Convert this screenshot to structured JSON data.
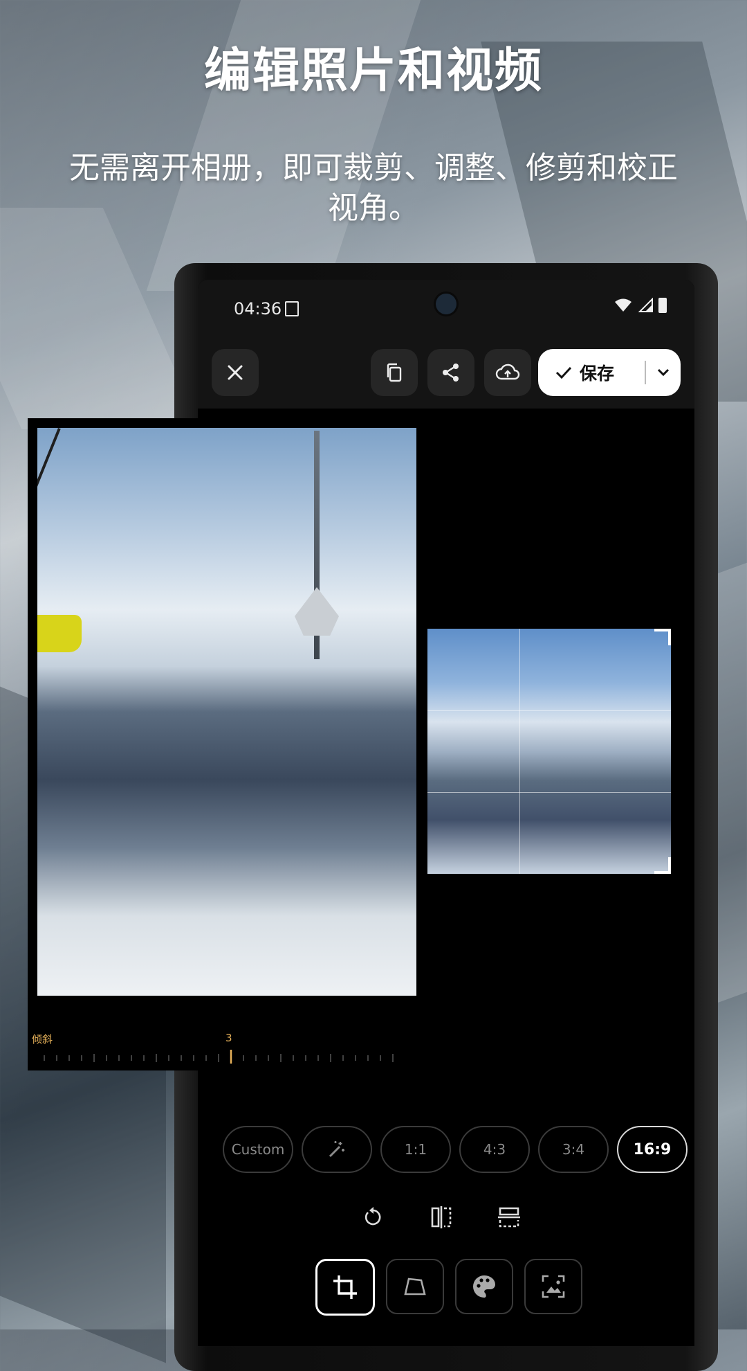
{
  "headline": "编辑照片和视频",
  "subline": "无需离开相册，即可裁剪、调整、修剪和校正视角。",
  "status": {
    "time": "04:36"
  },
  "toolbar": {
    "close_icon": "close-icon",
    "copy_icon": "copy-icon",
    "share_icon": "share-icon",
    "upload_icon": "cloud-upload-icon",
    "save_label": "保存"
  },
  "tilt": {
    "label": "倾斜",
    "value": "3"
  },
  "ratios": [
    {
      "label": "Custom",
      "active": false
    },
    {
      "label": "",
      "icon": "magic-wand-icon",
      "active": false
    },
    {
      "label": "1:1",
      "active": false
    },
    {
      "label": "4:3",
      "active": false
    },
    {
      "label": "3:4",
      "active": false
    },
    {
      "label": "16:9",
      "active": true
    }
  ],
  "tools": [
    "rotate-icon",
    "flip-horizontal-icon",
    "flip-vertical-icon"
  ],
  "tabs": [
    {
      "icon": "crop-icon",
      "active": true
    },
    {
      "icon": "perspective-icon",
      "active": false
    },
    {
      "icon": "palette-icon",
      "active": false
    },
    {
      "icon": "expand-image-icon",
      "active": false
    }
  ],
  "colors": {
    "accent": "#e7b25a",
    "background": "#000000",
    "save_bg": "#ffffff"
  }
}
